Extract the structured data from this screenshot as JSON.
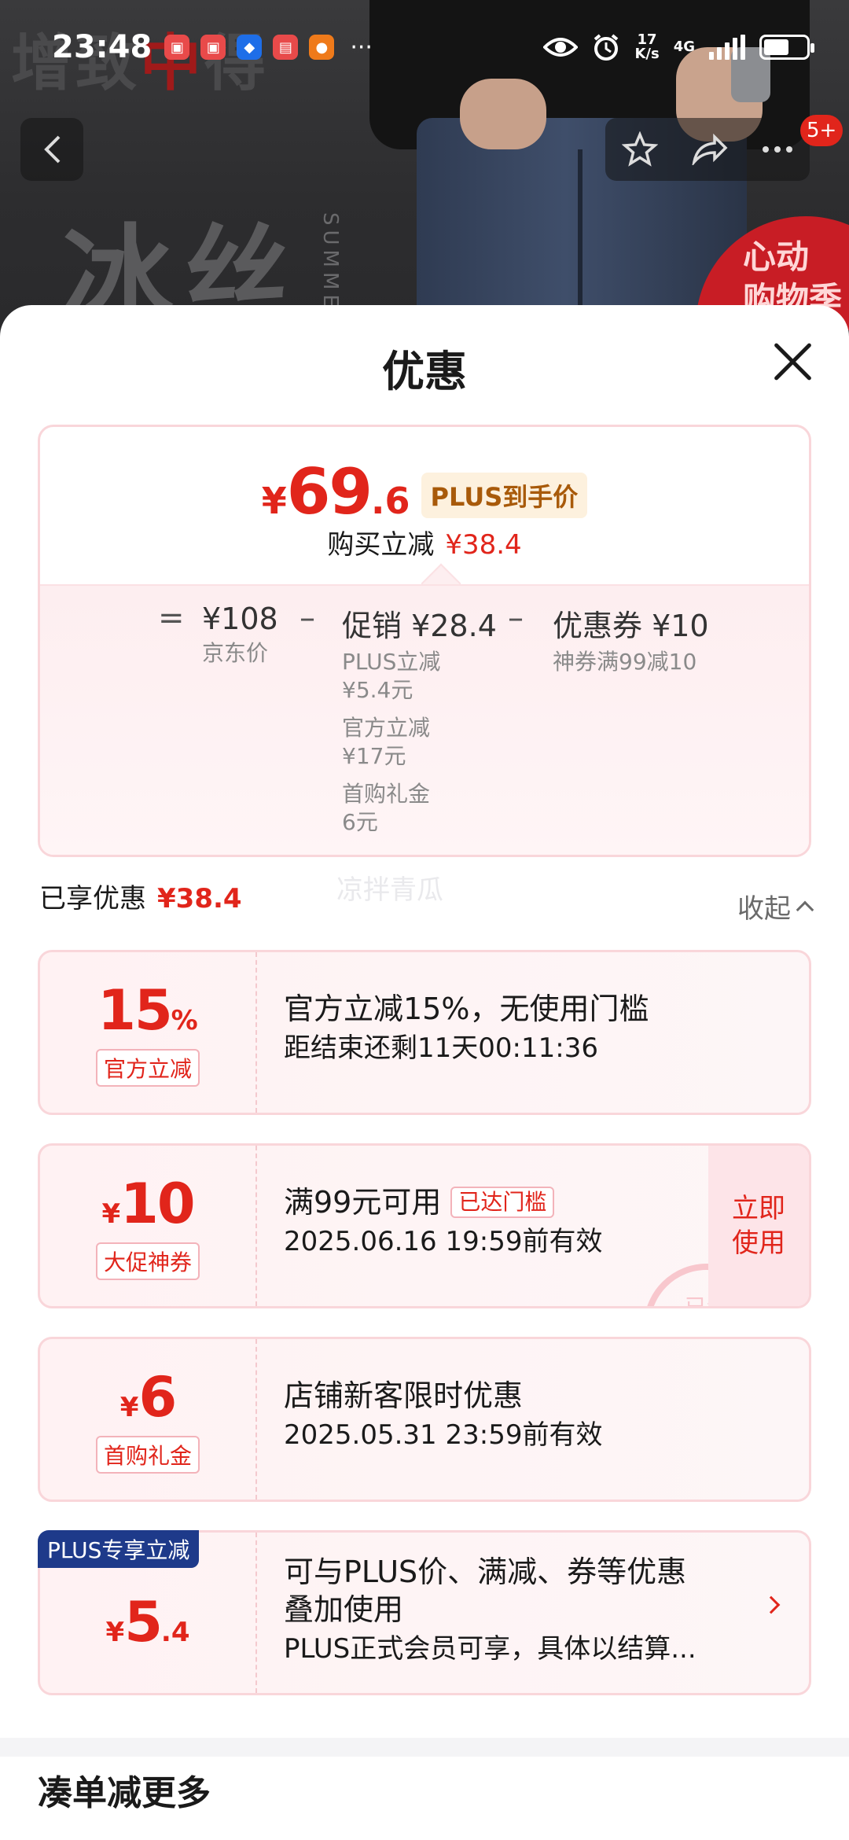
{
  "status_bar": {
    "time": "23:48",
    "app_icons": [
      "app-red-icon",
      "app-red-icon",
      "shield-app-icon",
      "app-red-icon",
      "app-orange-icon"
    ],
    "more": "···",
    "net_speed": "17",
    "net_unit": "K/s",
    "net_type": "4G"
  },
  "background": {
    "brand_text_a": "增致",
    "brand_text_b": "中",
    "brand_text_c": "得",
    "ice_text": "冰丝",
    "summer_text": "SUMMER",
    "promo_line1": "心动",
    "promo_line2": "购物季"
  },
  "nav": {
    "badge": "5+"
  },
  "sheet": {
    "title": "优惠"
  },
  "price_summary": {
    "yen": "¥",
    "final_int": "69",
    "final_dec": ".6",
    "plus_tag": "PLUS到手价",
    "reduce_label": "购买立减",
    "reduce_amount": "¥38.4",
    "eq": "=",
    "minus": "–",
    "jd_price": "¥108",
    "jd_price_label": "京东价",
    "promo_main": "促销 ¥28.4",
    "promo_items": [
      "PLUS立减",
      "¥5.4元",
      "官方立减",
      "¥17元",
      "首购礼金",
      "6元"
    ],
    "coupon_main": "优惠券 ¥10",
    "coupon_sub": "神券满99减10"
  },
  "enjoyed": {
    "label": "已享优惠",
    "amount": "¥38.4",
    "watermark": "凉拌青瓜",
    "collapse_label": "收起"
  },
  "coupons": [
    {
      "value_big": "15",
      "value_small": "%",
      "tag": "官方立减",
      "title": "官方立减15%，无使用门槛",
      "subtitle": "距结束还剩11天00:11:36"
    },
    {
      "value_prefix": "¥",
      "value_big": "10",
      "tag": "大促神券",
      "title": "满99元可用",
      "threshold_tag": "已达门槛",
      "subtitle": "2025.06.16 19:59前有效",
      "action": "立即使用",
      "stamp": "已领"
    },
    {
      "value_prefix": "¥",
      "value_big": "6",
      "tag": "首购礼金",
      "title": "店铺新客限时优惠",
      "subtitle": "2025.05.31 23:59前有效"
    },
    {
      "badge": "PLUS专享立减",
      "value_prefix": "¥",
      "value_big": "5",
      "value_small": ".4",
      "title": "可与PLUS价、满减、券等优惠叠加使用",
      "subtitle": "PLUS正式会员可享，具体以结算..."
    }
  ],
  "section": {
    "title": "凑单减更多"
  },
  "colors": {
    "accent_red": "#e1251b",
    "plus_blue": "#1e3a8a",
    "plus_gold": "#a85a0a"
  }
}
